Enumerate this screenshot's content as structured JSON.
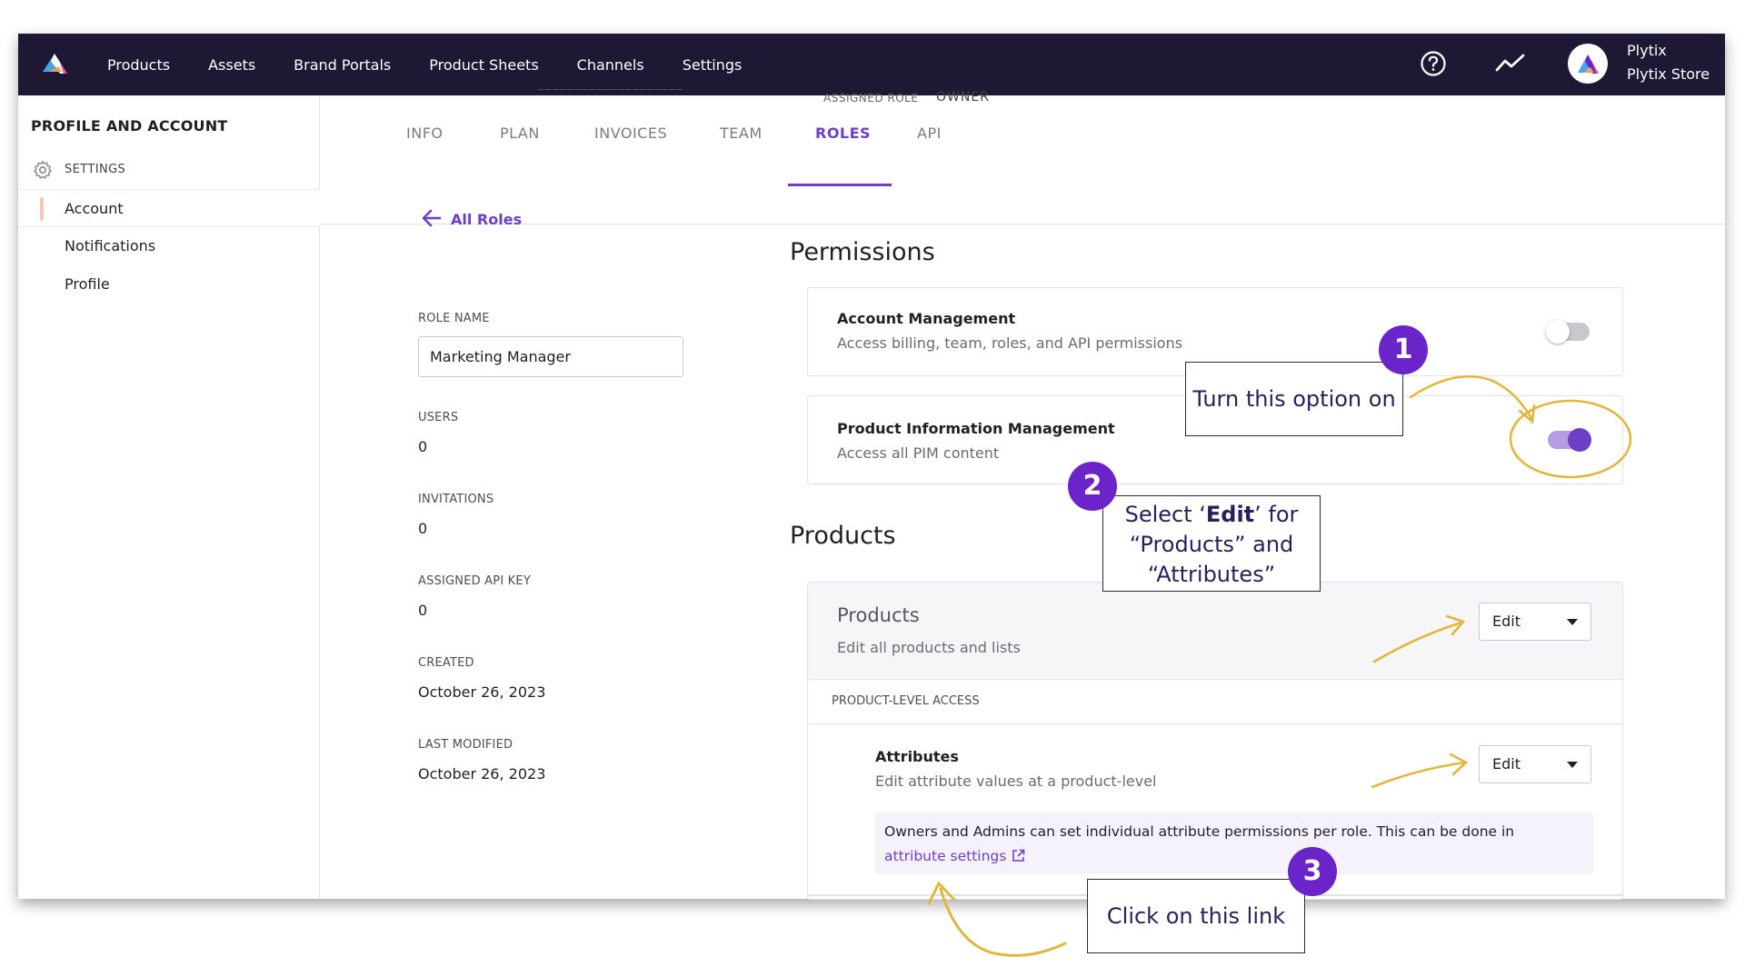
{
  "nav": {
    "items": [
      "Products",
      "Assets",
      "Brand Portals",
      "Product Sheets",
      "Channels",
      "Settings"
    ],
    "user_name": "Plytix",
    "store_name": "Plytix Store"
  },
  "header_clip": {
    "assigned_role_label": "ASSIGNED ROLE",
    "assigned_role_value": "OWNER"
  },
  "sidebar": {
    "title": "PROFILE AND ACCOUNT",
    "section": "SETTINGS",
    "items": [
      "Account",
      "Notifications",
      "Profile"
    ],
    "active": "Account"
  },
  "tabs": {
    "items": [
      "INFO",
      "PLAN",
      "INVOICES",
      "TEAM",
      "ROLES",
      "API"
    ],
    "active": "ROLES"
  },
  "role": {
    "back_label": "All Roles",
    "role_name_label": "ROLE NAME",
    "role_name_value": "Marketing Manager",
    "users_label": "USERS",
    "users_value": "0",
    "invitations_label": "INVITATIONS",
    "invitations_value": "0",
    "api_key_label": "ASSIGNED API KEY",
    "api_key_value": "0",
    "created_label": "CREATED",
    "created_value": "October 26, 2023",
    "modified_label": "LAST MODIFIED",
    "modified_value": "October 26, 2023"
  },
  "permissions": {
    "heading": "Permissions",
    "account_mgmt": {
      "title": "Account Management",
      "desc": "Access billing, team, roles, and API permissions",
      "enabled": false
    },
    "pim": {
      "title": "Product Information Management",
      "desc": "Access all PIM content",
      "enabled": true
    }
  },
  "products": {
    "heading": "Products",
    "card_title": "Products",
    "card_desc": "Edit all products and lists",
    "card_select": "Edit",
    "level_header": "PRODUCT-LEVEL ACCESS",
    "attributes_title": "Attributes",
    "attributes_desc": "Edit attribute values at a product-level",
    "attributes_select": "Edit",
    "note_text": "Owners and Admins can set individual attribute permissions per role. This can be done in ",
    "note_link": "attribute settings"
  },
  "annotations": {
    "step1_num": "1",
    "step1_text": "Turn this option on",
    "step2_num": "2",
    "step2_line1_pre": "Select ‘",
    "step2_line1_bold": "Edit",
    "step2_line1_post": "’ for",
    "step2_line2": "“Products” and",
    "step2_line3": "“Attributes”",
    "step3_num": "3",
    "step3_text": "Click on this link"
  },
  "colors": {
    "nav_bg": "#1e1835",
    "accent": "#6b3fc6",
    "badge": "#6a24c9",
    "annotation_arrow": "#e2b73d"
  },
  "icons": [
    "plytix-logo-icon",
    "help-circle-icon",
    "activity-trend-icon",
    "gear-icon",
    "arrow-left-icon",
    "external-link-icon",
    "chevron-down-icon"
  ]
}
